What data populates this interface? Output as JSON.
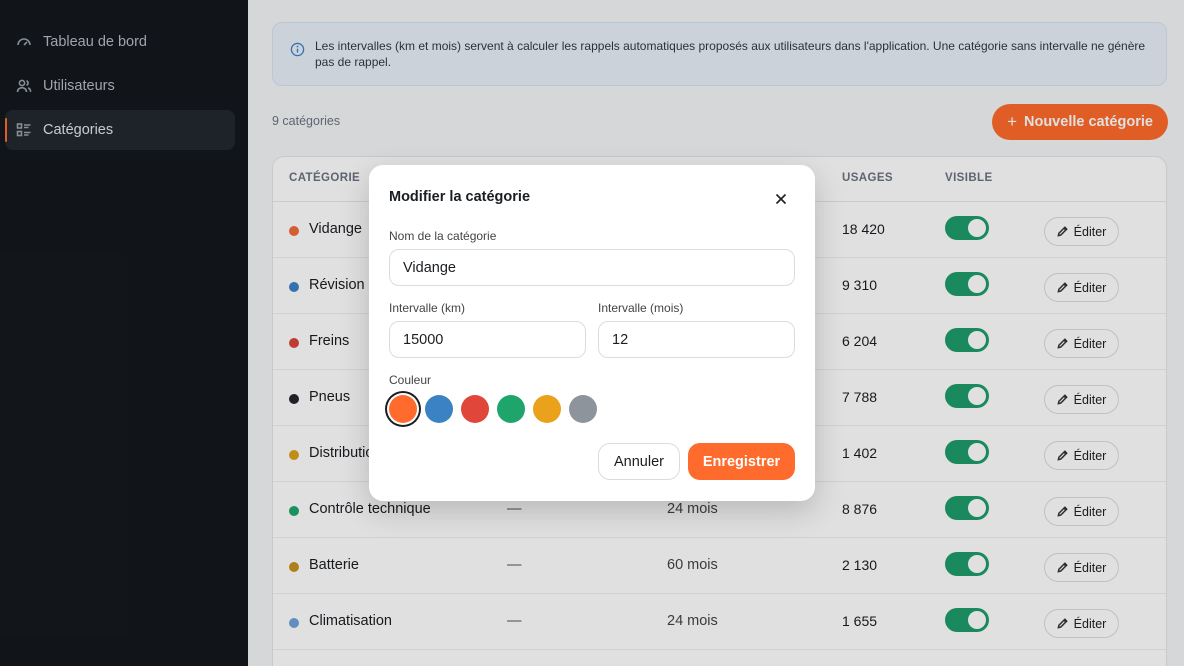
{
  "sidebar": {
    "items": [
      {
        "label": "Tableau de bord",
        "icon": "gauge-icon"
      },
      {
        "label": "Utilisateurs",
        "icon": "users-icon"
      },
      {
        "label": "Catégories",
        "icon": "list-icon",
        "active": true
      }
    ]
  },
  "info": {
    "text": "Les intervalles (km et mois) servent à calculer les rappels automatiques proposés aux utilisateurs dans l'application. Une catégorie sans intervalle ne génère pas de rappel."
  },
  "toolbar": {
    "count_label": "9 catégories",
    "new_button_label": "Nouvelle catégorie"
  },
  "table": {
    "headers": {
      "category": "CATÉGORIE",
      "usages": "USAGES",
      "visible": "VISIBLE"
    },
    "edit_label": "Éditer",
    "rows": [
      {
        "name": "Vidange",
        "color": "#f26b3a",
        "km": "",
        "mois": "",
        "usages": "18 420",
        "visible": true
      },
      {
        "name": "Révision",
        "color": "#3b82c4",
        "km": "",
        "mois": "",
        "usages": "9 310",
        "visible": true
      },
      {
        "name": "Freins",
        "color": "#d9473f",
        "km": "",
        "mois": "",
        "usages": "6 204",
        "visible": true
      },
      {
        "name": "Pneus",
        "color": "#23272e",
        "km": "",
        "mois": "",
        "usages": "7 788",
        "visible": true
      },
      {
        "name": "Distribution",
        "color": "#d9a21c",
        "km": "",
        "mois": "",
        "usages": "1 402",
        "visible": true
      },
      {
        "name": "Contrôle technique",
        "color": "#1fa56c",
        "km": "—",
        "mois": "24 mois",
        "usages": "8 876",
        "visible": true
      },
      {
        "name": "Batterie",
        "color": "#c8921c",
        "km": "—",
        "mois": "60 mois",
        "usages": "2 130",
        "visible": true
      },
      {
        "name": "Climatisation",
        "color": "#6ea3d8",
        "km": "—",
        "mois": "24 mois",
        "usages": "1 655",
        "visible": true
      }
    ]
  },
  "modal": {
    "title": "Modifier la catégorie",
    "name_label": "Nom de la catégorie",
    "name_value": "Vidange",
    "km_label": "Intervalle (km)",
    "km_value": "15000",
    "mois_label": "Intervalle (mois)",
    "mois_value": "12",
    "color_label": "Couleur",
    "colors": [
      "#ff6b2c",
      "#3b82c4",
      "#e0463a",
      "#1fa56c",
      "#eaa11b",
      "#8e949c"
    ],
    "selected_color": "#ff6b2c",
    "cancel_label": "Annuler",
    "save_label": "Enregistrer"
  }
}
